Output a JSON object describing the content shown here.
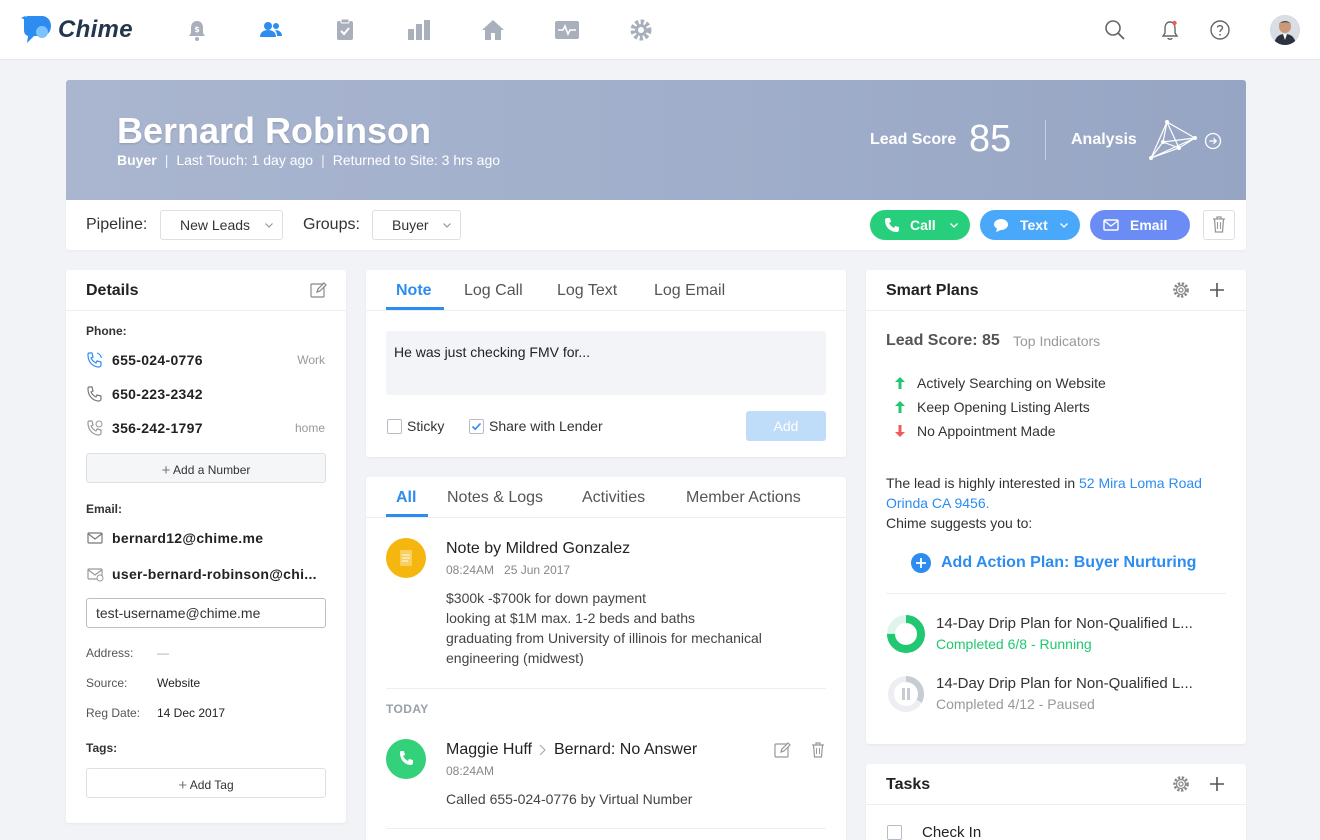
{
  "app": {
    "name": "Chime"
  },
  "nav": {
    "items": [
      "bell-dollar-icon",
      "people-icon",
      "clipboard-check-icon",
      "bar-chart-icon",
      "home-icon",
      "activity-icon",
      "gear-icon"
    ],
    "active": "people-icon"
  },
  "lead": {
    "name": "Bernard Robinson",
    "type": "Buyer",
    "last_touch": "Last Touch: 1 day ago",
    "returned": "Returned to Site: 3 hrs ago",
    "score_label": "Lead Score",
    "score": "85",
    "analysis_label": "Analysis"
  },
  "pipeline": {
    "pipeline_label": "Pipeline:",
    "pipeline_value": "New Leads",
    "groups_label": "Groups:",
    "groups_value": "Buyer",
    "call": "Call",
    "text": "Text",
    "email": "Email"
  },
  "details": {
    "title": "Details",
    "phone_label": "Phone:",
    "phones": [
      {
        "number": "655-024-0776",
        "tag": "Work"
      },
      {
        "number": "650-223-2342",
        "tag": ""
      },
      {
        "number": "356-242-1797",
        "tag": "home"
      }
    ],
    "add_number": "Add a Number",
    "email_label": "Email:",
    "emails": [
      "bernard12@chime.me",
      "user-bernard-robinson@chi..."
    ],
    "email_input": "test-username@chime.me",
    "address_label": "Address:",
    "address_value": "—",
    "source_label": "Source:",
    "source_value": "Website",
    "reg_label": "Reg Date:",
    "reg_value": "14 Dec 2017",
    "tags_label": "Tags:",
    "add_tag": "Add Tag"
  },
  "note": {
    "tabs": [
      "Note",
      "Log Call",
      "Log Text",
      "Log Email"
    ],
    "active_tab": "Note",
    "text": "He was just checking FMV for...",
    "sticky": "Sticky",
    "share": "Share with Lender",
    "add": "Add"
  },
  "activity": {
    "tabs": [
      "All",
      "Notes & Logs",
      "Activities",
      "Member Actions"
    ],
    "active_tab": "All",
    "item1": {
      "title": "Note by Mildred Gonzalez",
      "time": "08:24AM",
      "date": "25 Jun 2017",
      "lines": [
        "$300k -$700k for down payment",
        "looking at $1M max. 1-2 beds and baths",
        "graduating from University of illinois for mechanical engineering (midwest)"
      ]
    },
    "today": "TODAY",
    "item2": {
      "from": "Maggie Huff",
      "to": "Bernard: No Answer",
      "time": "08:24AM",
      "body": "Called 655-024-0776 by Virtual Number"
    }
  },
  "smart_plans": {
    "title": "Smart Plans",
    "lead_score": "Lead Score: 85",
    "top_indicators": "Top Indicators",
    "indicators": [
      {
        "text": "Actively Searching on Website",
        "dir": "up"
      },
      {
        "text": "Keep Opening Listing Alerts",
        "dir": "up"
      },
      {
        "text": "No Appointment Made",
        "dir": "down"
      }
    ],
    "interest_prefix": "The lead is highly interested in ",
    "interest_link": "52 Mira Loma Road Orinda CA 9456.",
    "suggest": "Chime suggests you to:",
    "action": "Add Action Plan: Buyer Nurturing",
    "plans": [
      {
        "name": "14-Day Drip Plan for Non-Qualified L...",
        "status": "Completed 6/8 - Running",
        "progress": 0.75,
        "state": "running"
      },
      {
        "name": "14-Day Drip Plan for Non-Qualified L...",
        "status": "Completed 4/12 - Paused",
        "progress": 0.33,
        "state": "paused"
      }
    ]
  },
  "tasks": {
    "title": "Tasks",
    "items": [
      "Check In"
    ]
  },
  "colors": {
    "accent": "#2d8cf0",
    "call": "#27cf7c",
    "text": "#4aa8fb",
    "email": "#6b8cf5",
    "hero": "#a3b0cb",
    "note_icon": "#f5b70f",
    "call_icon": "#33d17a",
    "up": "#21c871",
    "down": "#f25a5a"
  }
}
